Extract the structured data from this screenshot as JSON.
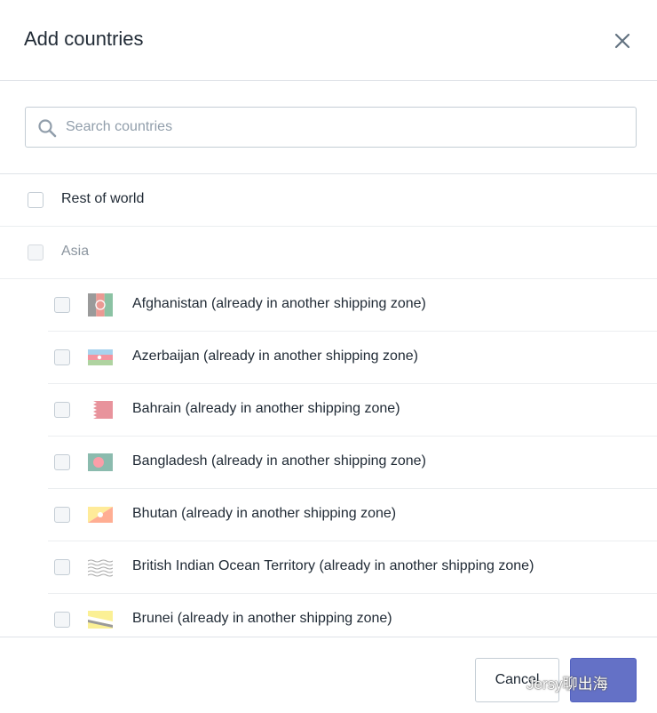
{
  "dialog": {
    "title": "Add countries",
    "close_icon": "close-icon"
  },
  "search": {
    "placeholder": "Search countries",
    "value": "",
    "icon": "search-icon"
  },
  "list": {
    "rest_of_world": "Rest of world",
    "group": "Asia",
    "countries": [
      {
        "label": "Afghanistan (already in another shipping zone)",
        "flag": "flag-afghanistan-icon"
      },
      {
        "label": "Azerbaijan (already in another shipping zone)",
        "flag": "flag-azerbaijan-icon"
      },
      {
        "label": "Bahrain (already in another shipping zone)",
        "flag": "flag-bahrain-icon"
      },
      {
        "label": "Bangladesh (already in another shipping zone)",
        "flag": "flag-bangladesh-icon"
      },
      {
        "label": "Bhutan (already in another shipping zone)",
        "flag": "flag-bhutan-icon"
      },
      {
        "label": "British Indian Ocean Territory (already in another shipping zone)",
        "flag": "flag-british-indian-ocean-territory-icon"
      },
      {
        "label": "Brunei (already in another shipping zone)",
        "flag": "flag-brunei-icon"
      }
    ]
  },
  "footer": {
    "cancel_label": "Cancel",
    "primary_label": "",
    "watermark": "Jersy聊出海"
  },
  "colors": {
    "primary": "#5c6ac4",
    "text": "#212b36",
    "placeholder": "#919eab",
    "border": "#dfe3e8"
  }
}
